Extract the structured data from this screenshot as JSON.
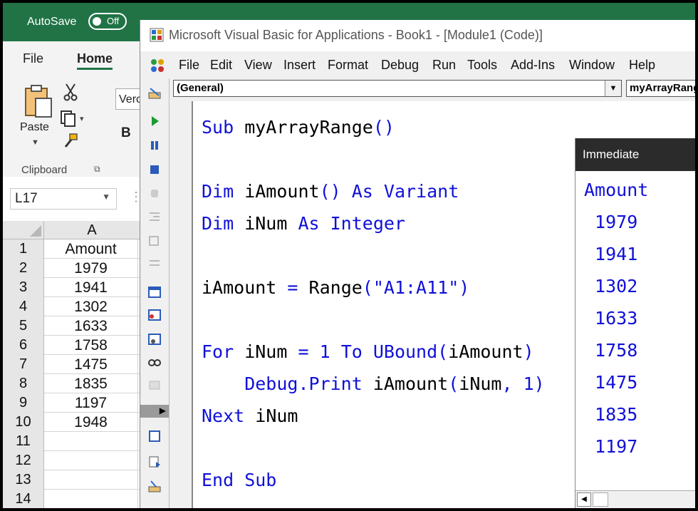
{
  "excel": {
    "autosave_label": "AutoSave",
    "autosave_state": "Off",
    "tabs": [
      "File",
      "Home"
    ],
    "clipboard": {
      "paste_label": "Paste",
      "group_label": "Clipboard"
    },
    "font_name": "Verc",
    "bold_label": "B",
    "name_box": "L17",
    "column_header": "A",
    "rows": [
      {
        "num": "1",
        "value": "Amount"
      },
      {
        "num": "2",
        "value": "1979"
      },
      {
        "num": "3",
        "value": "1941"
      },
      {
        "num": "4",
        "value": "1302"
      },
      {
        "num": "5",
        "value": "1633"
      },
      {
        "num": "6",
        "value": "1758"
      },
      {
        "num": "7",
        "value": "1475"
      },
      {
        "num": "8",
        "value": "1835"
      },
      {
        "num": "9",
        "value": "1197"
      },
      {
        "num": "10",
        "value": "1948"
      },
      {
        "num": "11",
        "value": ""
      },
      {
        "num": "12",
        "value": ""
      },
      {
        "num": "13",
        "value": ""
      },
      {
        "num": "14",
        "value": ""
      }
    ]
  },
  "vba": {
    "title": "Microsoft Visual Basic for Applications - Book1 - [Module1 (Code)]",
    "menu": [
      "File",
      "Edit",
      "View",
      "Insert",
      "Format",
      "Debug",
      "Run",
      "Tools",
      "Add-Ins",
      "Window",
      "Help"
    ],
    "object_combo": "(General)",
    "procedure_combo": "myArrayRange",
    "code": {
      "l1a": "Sub",
      "l1b": " myArrayRange",
      "l1c": "()",
      "l2a": "Dim",
      "l2b": " iAmount",
      "l2c": "()",
      "l2d": " As Variant",
      "l3a": "Dim",
      "l3b": " iNum ",
      "l3c": "As Integer",
      "l4a": "iAmount ",
      "l4b": "=",
      "l4c": " Range",
      "l4d": "(\"A1:A11\")",
      "l5a": "For",
      "l5b": " iNum ",
      "l5c": "=",
      "l5d": " 1 ",
      "l5e": "To",
      "l5f": " UBound",
      "l5g": "(",
      "l5h": "iAmount",
      "l5i": ")",
      "l6a": "    Debug.Print",
      "l6b": " iAmount",
      "l6c": "(",
      "l6d": "iNum",
      "l6e": ", ",
      "l6f": "1",
      "l6g": ")",
      "l7a": "Next",
      "l7b": " iNum",
      "l8a": "End Sub"
    },
    "immediate": {
      "title": "Immediate",
      "lines": [
        "Amount",
        " 1979",
        " 1941",
        " 1302",
        " 1633",
        " 1758",
        " 1475",
        " 1835",
        " 1197"
      ]
    }
  },
  "colors": {
    "excel_green": "#217346",
    "vba_keyword": "#1010d8",
    "immediate_header": "#2b2b2b"
  }
}
